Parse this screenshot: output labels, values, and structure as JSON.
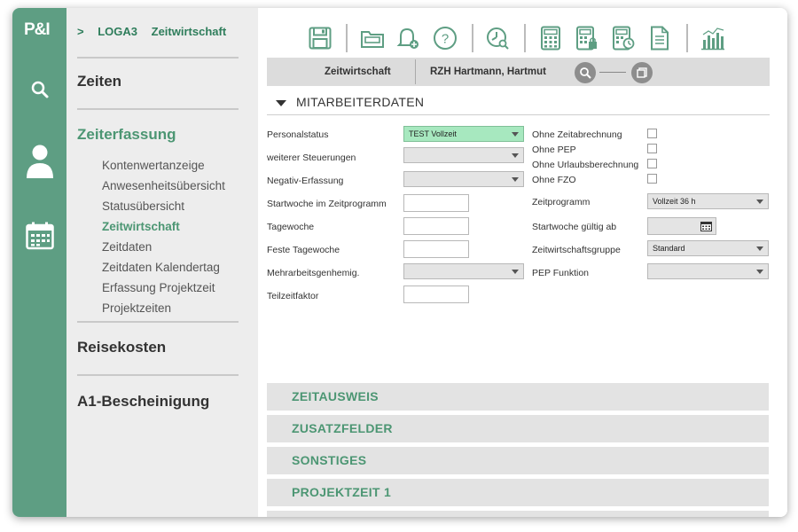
{
  "logo": "P&I",
  "breadcrumb": {
    "arrow": ">",
    "items": [
      "LOGA3",
      "Zeitwirtschaft"
    ]
  },
  "nav": {
    "zeiten": "Zeiten",
    "zeiterfassung": "Zeiterfassung",
    "sub_items": [
      "Kontenwertanzeige",
      "Anwesenheitsübersicht",
      "Statusübersicht",
      "Zeitwirtschaft",
      "Zeitdaten",
      "Zeitdaten Kalendertag",
      "Erfassung Projektzeit",
      "Projektzeiten"
    ],
    "active_sub": "Zeitwirtschaft",
    "reisekosten": "Reisekosten",
    "a1": "A1-Bescheinigung"
  },
  "toolbar_icons": [
    "save-icon",
    "folder-icon",
    "bell-add-icon",
    "help-icon",
    "clock-search-icon",
    "calculator-icon",
    "calculator-lock-icon",
    "calculator-clock-icon",
    "document-icon",
    "chart-icon"
  ],
  "context_bar": {
    "module": "Zeitwirtschaft",
    "employee": "RZH Hartmann, Hartmut"
  },
  "section": {
    "title": "MITARBEITERDATEN"
  },
  "form_left": {
    "personalstatus_label": "Personalstatus",
    "personalstatus_value": "TEST Vollzeit",
    "steuerungen_label": "weiterer Steuerungen",
    "steuerungen_value": "",
    "negativ_label": "Negativ-Erfassung",
    "negativ_value": "",
    "startwoche_label": "Startwoche im Zeitprogramm",
    "tagewoche_label": "Tagewoche",
    "feste_label": "Feste Tagewoche",
    "mehrarbeit_label": "Mehrarbeitsgenhemig.",
    "mehrarbeit_value": "",
    "teilzeit_label": "Teilzeitfaktor"
  },
  "form_right": {
    "ohne_zeit_label": "Ohne Zeitabrechnung",
    "ohne_pep_label": "Ohne PEP",
    "ohne_urlaub_label": "Ohne Urlaubsberechnung",
    "ohne_fzo_label": "Ohne FZO",
    "zeitprogramm_label": "Zeitprogramm",
    "zeitprogramm_value": "Vollzeit 36 h",
    "startwoche_gueltig_label": "Startwoche gültig ab",
    "gruppe_label": "Zeitwirtschaftsgruppe",
    "gruppe_value": "Standard",
    "pep_funktion_label": "PEP Funktion",
    "pep_funktion_value": ""
  },
  "accordions": [
    "ZEITAUSWEIS",
    "ZUSATZFELDER",
    "SONSTIGES",
    "PROJEKTZEIT 1"
  ],
  "colors": {
    "rail": "#5e9e83",
    "accent": "#4c9673",
    "sidebar": "#ededed",
    "selected_field": "#a7e8bf"
  }
}
